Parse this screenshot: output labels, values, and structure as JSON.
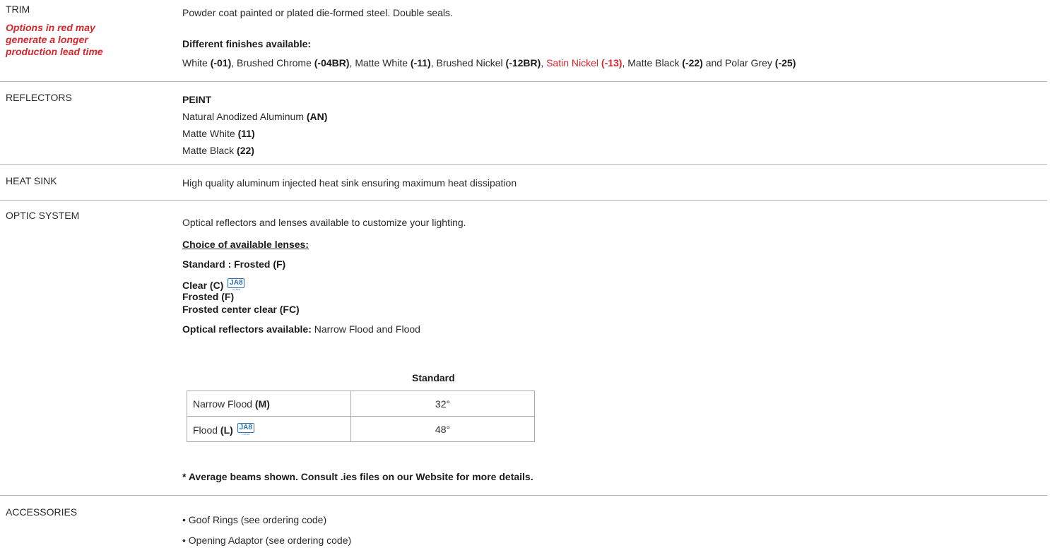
{
  "trim": {
    "label": "TRIM",
    "note_line1": "Options in red may",
    "note_line2": "generate a longer",
    "note_line3": "production lead time",
    "description": "Powder coat painted or plated die-formed steel.  Double seals.",
    "finishes_heading": "Different finishes available:",
    "finishes": [
      {
        "name": "White ",
        "code": "(-01)",
        "sep": ", ",
        "red": false
      },
      {
        "name": "Brushed Chrome ",
        "code": "(-04BR)",
        "sep": ", ",
        "red": false
      },
      {
        "name": "Matte White ",
        "code": "(-11)",
        "sep": ", ",
        "red": false
      },
      {
        "name": "Brushed Nickel ",
        "code": "(-12BR)",
        "sep": ", ",
        "red": false
      },
      {
        "name": "Satin Nickel ",
        "code": "(-13)",
        "sep": ", ",
        "red": true
      },
      {
        "name": "Matte Black ",
        "code": "(-22)",
        "sep": " and ",
        "red": false
      },
      {
        "name": "Polar Grey ",
        "code": "(-25)",
        "sep": "",
        "red": false
      }
    ]
  },
  "reflectors": {
    "label": "REFLECTORS",
    "heading": "PEINT",
    "items": [
      {
        "name": "Natural Anodized Aluminum ",
        "code": "(AN)"
      },
      {
        "name": "Matte White ",
        "code": "(11)"
      },
      {
        "name": "Matte Black ",
        "code": "(22)"
      }
    ]
  },
  "heat_sink": {
    "label": "HEAT SINK",
    "description": "High quality aluminum injected heat sink ensuring maximum heat dissipation"
  },
  "optic_system": {
    "label": "OPTIC SYSTEM",
    "description": "Optical reflectors and lenses available to customize your lighting.",
    "lenses_heading": "Choice of available lenses:",
    "standard_lens": "Standard : Frosted (F)",
    "lenses": [
      "Clear (C)",
      "Frosted (F)",
      "Frosted center clear (FC)"
    ],
    "reflectors_label": "Optical reflectors available:",
    "reflectors_value": " Narrow Flood and Flood",
    "table_header": "Standard",
    "table_rows": [
      {
        "name": "Narrow Flood ",
        "code": "(M)",
        "value": "32°",
        "ja8": false
      },
      {
        "name": "Flood ",
        "code": "(L)",
        "value": "48°",
        "ja8": true
      }
    ],
    "footnote": "* Average beams shown. Consult .ies files on our Website for more details."
  },
  "ja8_badge": {
    "text": "JA8",
    "sub": "LISTED",
    "color": "#2c6fb5"
  },
  "accessories": {
    "label": "ACCESSORIES",
    "items": [
      "• Goof Rings (see ordering code)",
      "• Opening Adaptor (see ordering code)"
    ]
  },
  "colors": {
    "accent_red": "#d8262d",
    "rule": "#b5b5b5",
    "text": "#2b2b2b"
  }
}
